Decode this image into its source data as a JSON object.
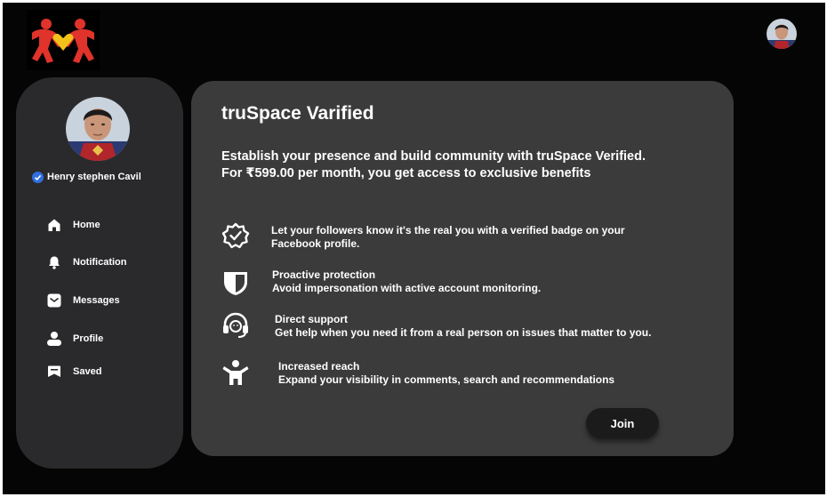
{
  "app": {
    "logo_icon": "people-heart-logo",
    "user_avatar_icon": "user-avatar"
  },
  "sidebar": {
    "user_name": "Henry stephen Cavil",
    "verified_icon": "verified-check-icon",
    "items": [
      {
        "label": "Home",
        "icon": "home-icon"
      },
      {
        "label": "Notification",
        "icon": "bell-icon"
      },
      {
        "label": "Messages",
        "icon": "mail-icon"
      },
      {
        "label": "Profile",
        "icon": "user-icon"
      },
      {
        "label": "Saved",
        "icon": "bookmark-icon"
      }
    ]
  },
  "panel": {
    "title": "truSpace Varified",
    "intro": "Establish your presence and build community with truSpace Verified. For ₹599.00 per month, you get access to exclusive benefits",
    "benefits": [
      {
        "icon": "verified-badge-icon",
        "title": "Let your followers know it's the real you with a verified badge on your",
        "text": "Facebook profile."
      },
      {
        "icon": "shield-icon",
        "title": "Proactive protection",
        "text": "Avoid impersonation with active account monitoring."
      },
      {
        "icon": "support-headset-icon",
        "title": "Direct support",
        "text": "Get help when you need it from a real person on issues that matter to you."
      },
      {
        "icon": "reach-person-icon",
        "title": "Increased reach",
        "text": "Expand your visibility in comments, search and recommendations"
      }
    ],
    "join_label": "Join"
  },
  "colors": {
    "background": "#050505",
    "sidebar": "#2a2a2c",
    "panel": "#3b3b3c",
    "verified_blue": "#2f6fe0",
    "logo_red": "#e0332b",
    "logo_yellow": "#f2c21b",
    "button": "#1b1b1b"
  }
}
